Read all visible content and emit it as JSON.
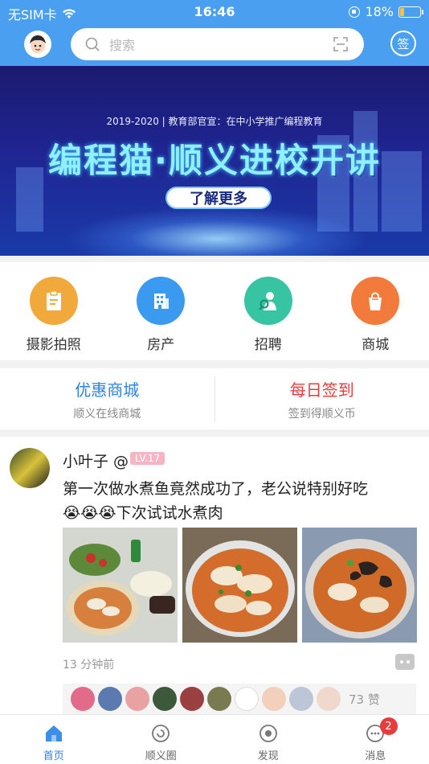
{
  "status_bar": {
    "carrier": "无SIM卡",
    "time": "16:46",
    "battery": "18%"
  },
  "header": {
    "search_placeholder": "搜索",
    "sign_label": "签"
  },
  "banner": {
    "subline": "2019-2020 | 教育部官宣：在中小学推广编程教育",
    "headline": "编程猫·顺义进校开讲",
    "cta": "了解更多"
  },
  "categories": [
    {
      "label": "摄影拍照",
      "color": "#f2a93b",
      "icon": "clipboard-icon"
    },
    {
      "label": "房产",
      "color": "#3a9aef",
      "icon": "building-icon"
    },
    {
      "label": "招聘",
      "color": "#36c4a2",
      "icon": "person-search-icon"
    },
    {
      "label": "商城",
      "color": "#f27a3a",
      "icon": "shopping-bag-icon"
    }
  ],
  "promos": [
    {
      "title": "优惠商城",
      "subtitle": "顺义在线商城",
      "color": "#2b82e8"
    },
    {
      "title": "每日签到",
      "subtitle": "签到得顺义币",
      "color": "#e83c3c"
    }
  ],
  "post": {
    "author": "小叶子 @",
    "level": "LV.17",
    "text_line1": "第一次做水煮鱼竟然成功了，老公说特别好吃",
    "text_line2": "😭😭😭下次试试水煮肉",
    "time": "13 分钟前",
    "likes": "73 赞"
  },
  "tabs": [
    {
      "label": "首页",
      "icon": "home-icon"
    },
    {
      "label": "顺义圈",
      "icon": "circle-icon"
    },
    {
      "label": "发现",
      "icon": "discover-icon"
    },
    {
      "label": "消息",
      "icon": "message-icon",
      "badge": "2"
    }
  ]
}
